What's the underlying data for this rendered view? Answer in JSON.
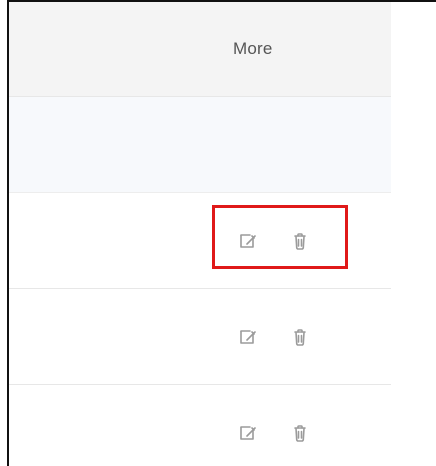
{
  "table": {
    "columns": {
      "more_label": "More"
    },
    "rows": [
      {
        "actions": [
          "edit-icon",
          "delete-icon"
        ]
      },
      {
        "actions": [
          "edit-icon",
          "delete-icon"
        ]
      },
      {
        "actions": [
          "edit-icon",
          "delete-icon"
        ]
      }
    ]
  },
  "annotation": {
    "highlight_color": "#e01919"
  },
  "colors": {
    "header_bg": "#f4f4f4",
    "empty_row_bg": "#f7f9fc",
    "icon_gray": "#9b9b9b",
    "text": "#555555"
  }
}
